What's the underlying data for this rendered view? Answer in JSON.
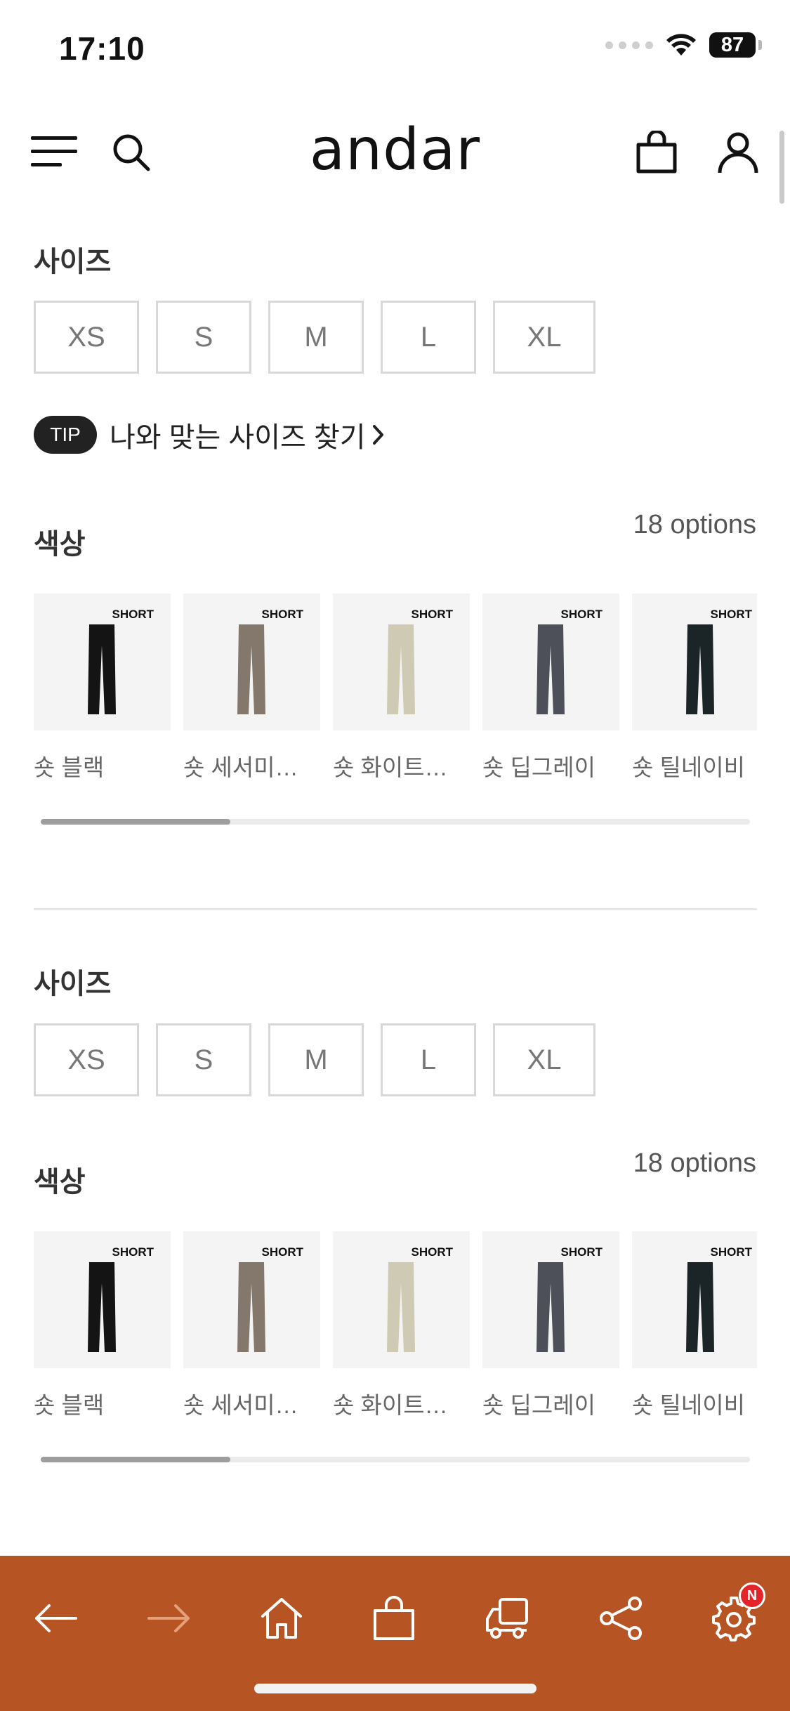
{
  "status_bar": {
    "time": "17:10",
    "battery": "87"
  },
  "header": {
    "logo": "andar"
  },
  "section1": {
    "size_title": "사이즈",
    "sizes": [
      "XS",
      "S",
      "M",
      "L",
      "XL"
    ],
    "tip_badge": "TIP",
    "tip_text": "나와 맞는 사이즈 찾기",
    "color_title": "색상",
    "options_count": "18 options"
  },
  "section2": {
    "size_title": "사이즈",
    "sizes": [
      "XS",
      "S",
      "M",
      "L",
      "XL"
    ],
    "color_title": "색상",
    "options_count": "18 options"
  },
  "swatches": [
    {
      "tag": "SHORT",
      "name": "숏 블랙",
      "color": "#141414"
    },
    {
      "tag": "SHORT",
      "name": "숏 세서미브…",
      "color": "#84776b"
    },
    {
      "tag": "SHORT",
      "name": "숏 화이트머…",
      "color": "#cfcab3"
    },
    {
      "tag": "SHORT",
      "name": "숏 딥그레이",
      "color": "#4d5059"
    },
    {
      "tag": "SHORT",
      "name": "숏 틸네이비",
      "color": "#1b2427"
    }
  ],
  "colors": {
    "toolbar": "#b75423",
    "badge": "#e5242a"
  },
  "toolbar": {
    "icons": [
      "back-arrow-icon",
      "forward-arrow-icon",
      "home-icon",
      "shopping-bag-icon",
      "delivery-truck-icon",
      "share-icon",
      "settings-gear-icon"
    ],
    "settings_badge": "N"
  }
}
